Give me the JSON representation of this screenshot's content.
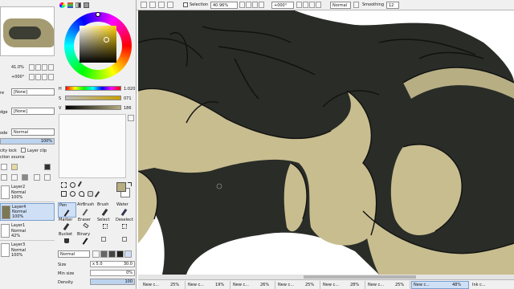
{
  "colors": {
    "canvas_dark": "#2a2c27",
    "fur_tan": "#c7bd8f",
    "panel_bg": "#f0f0f0",
    "primary_swatch": "#b7ad82",
    "selected_layer": "#cfe0f6"
  },
  "navigator": {
    "zoom": "41.0%",
    "angle": "+000°"
  },
  "hsv": {
    "h_label": "H",
    "h_value": "1:020",
    "s_label": "S",
    "s_value": "071",
    "v_label": "V",
    "v_value": "186"
  },
  "layer_props": {
    "texture_label": "re",
    "texture_value": "[None]",
    "effect_label": "dge",
    "effect_value": "[None]",
    "mode_label": "ode",
    "mode_value": "Normal",
    "opacity_value": "100%",
    "lock_label": "city lock",
    "clip_label": "Layer clip",
    "source_label": "ction source"
  },
  "layers": [
    {
      "name": "Layer2",
      "mode": "Normal",
      "opacity": "100%"
    },
    {
      "name": "Layer4",
      "mode": "Normal",
      "opacity": "100%"
    },
    {
      "name": "Layer1",
      "mode": "Normal",
      "opacity": "42%"
    },
    {
      "name": "Layer3",
      "mode": "Normal",
      "opacity": "100%"
    }
  ],
  "tools": [
    {
      "label": "Pen"
    },
    {
      "label": "AirBrush"
    },
    {
      "label": "Brush"
    },
    {
      "label": "Water"
    },
    {
      "label": "Marker"
    },
    {
      "label": "Eraser"
    },
    {
      "label": "Select"
    },
    {
      "label": "Deselect"
    },
    {
      "label": "Bucket"
    },
    {
      "label": "Binary"
    }
  ],
  "brush": {
    "mode_value": "Normal",
    "size_label": "Size",
    "size_mult": "x 5.0",
    "size_value": "30.0",
    "min_label": "Min size",
    "min_value": "0%",
    "density_label": "Density",
    "density_value": "100"
  },
  "toolbar": {
    "selection_label": "Selection",
    "zoom": "40.96%",
    "angle": "+000°",
    "blend_mode": "Normal",
    "smoothing_label": "Smoothing",
    "smoothing_value": "12"
  },
  "canvas_tabs": [
    {
      "name": "New c...",
      "pct": "25%"
    },
    {
      "name": "New c...",
      "pct": "19%"
    },
    {
      "name": "New c...",
      "pct": "26%"
    },
    {
      "name": "New c...",
      "pct": "25%"
    },
    {
      "name": "New c...",
      "pct": "28%"
    },
    {
      "name": "New c...",
      "pct": "25%"
    },
    {
      "name": "New c...",
      "pct": "48%"
    },
    {
      "name": "Ink c...",
      "pct": ""
    }
  ]
}
